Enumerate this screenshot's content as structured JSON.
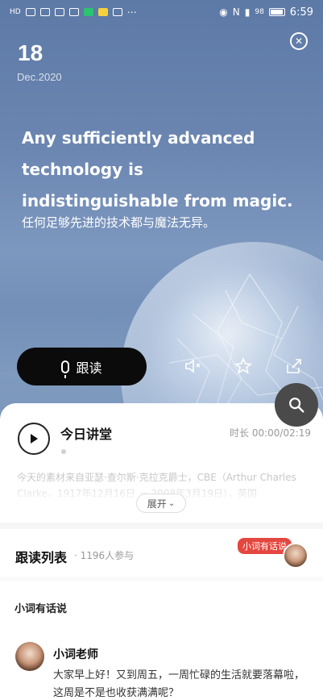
{
  "status_bar": {
    "left_text": "HD",
    "time": "6:59",
    "battery": "98"
  },
  "hero": {
    "day": "18",
    "month_year": "Dec.2020",
    "quote_en": "Any sufficiently advanced technology is indistinguishable from magic.",
    "quote_zh": "任何足够先进的技术都与魔法无异。",
    "follow_button_label": "跟读"
  },
  "lecture": {
    "title": "今日讲堂",
    "duration": "时长 00:00/02:19",
    "description": "今天的素材来自亚瑟·查尔斯·克拉克爵士，CBE（Arthur Charles Clarke，1917年12月16日 － 2008年3月19日），英国",
    "expand_label": "展开"
  },
  "follow_list": {
    "title": "跟读列表",
    "count": "· 1196人参与",
    "badge": "小词有话说"
  },
  "talk_section": {
    "title": "小词有话说",
    "author": "小词老师",
    "message": "大家早上好！又到周五，一周忙碌的生活就要落幕啦，这周是不是也收获满满呢？"
  },
  "colors": {
    "hero_blue": "#6b86b1",
    "follow_button": "#0b0b0b",
    "badge_red": "#e4473f"
  }
}
